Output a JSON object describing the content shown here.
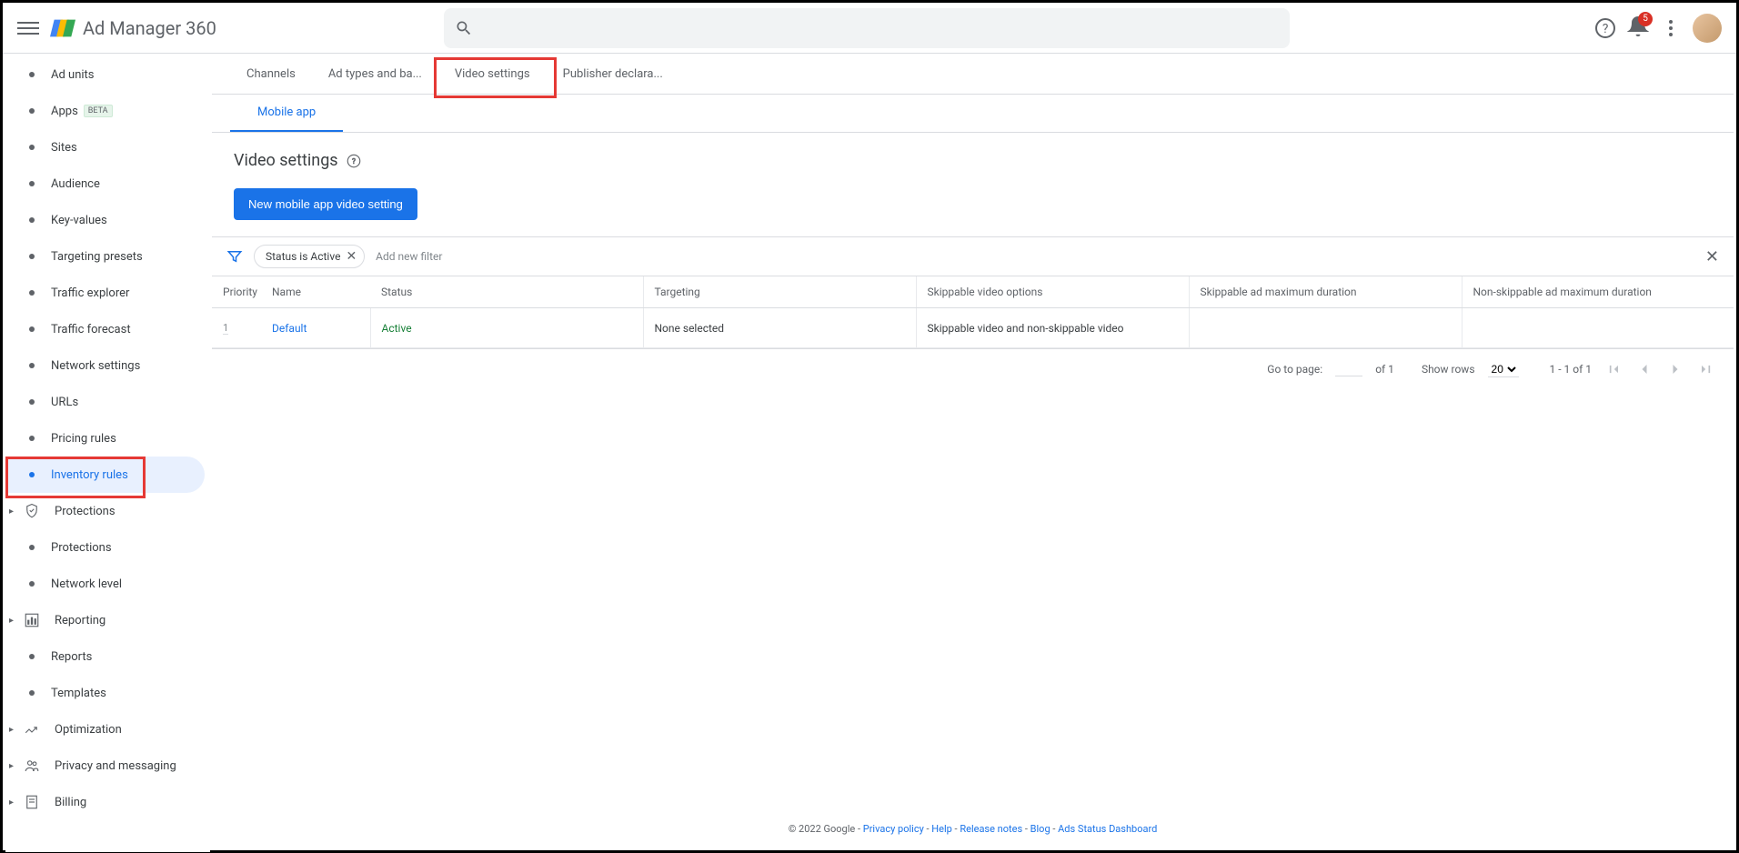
{
  "header": {
    "product": "Ad Manager 360",
    "notif_count": "5"
  },
  "sidebar": {
    "items": [
      {
        "label": "Ad units"
      },
      {
        "label": "Apps",
        "badge": "BETA"
      },
      {
        "label": "Sites"
      },
      {
        "label": "Audience"
      },
      {
        "label": "Key-values"
      },
      {
        "label": "Targeting presets"
      },
      {
        "label": "Traffic explorer"
      },
      {
        "label": "Traffic forecast"
      },
      {
        "label": "Network settings"
      },
      {
        "label": "URLs"
      },
      {
        "label": "Pricing rules"
      },
      {
        "label": "Inventory rules",
        "active": true,
        "highlighted": true
      },
      {
        "label": "Protections",
        "icon": "shield",
        "expandable": true
      },
      {
        "label": "Protections"
      },
      {
        "label": "Network level"
      },
      {
        "label": "Reporting",
        "icon": "chart",
        "expandable": true
      },
      {
        "label": "Reports"
      },
      {
        "label": "Templates"
      },
      {
        "label": "Optimization",
        "icon": "trend",
        "expandable": true
      },
      {
        "label": "Privacy and messaging",
        "icon": "people",
        "expandable": true
      },
      {
        "label": "Billing",
        "icon": "receipt",
        "expandable": true
      }
    ]
  },
  "tabs": {
    "row1": [
      "Channels",
      "Ad types and ba...",
      "Video settings",
      "Publisher declara..."
    ],
    "row1_active": 2,
    "row1_highlighted": 2,
    "row2": [
      "Mobile app"
    ],
    "row2_active": 0
  },
  "page": {
    "title": "Video settings",
    "new_button": "New mobile app video setting"
  },
  "filters": {
    "chip": "Status is Active",
    "add_placeholder": "Add new filter"
  },
  "table": {
    "columns": [
      "Priority",
      "Name",
      "Status",
      "Targeting",
      "Skippable video options",
      "Skippable ad maximum duration",
      "Non-skippable ad maximum duration"
    ],
    "rows": [
      {
        "priority": "1",
        "name": "Default",
        "status": "Active",
        "targeting": "None selected",
        "skippable": "Skippable video and non-skippable video",
        "sk_max": "",
        "nonsk_max": ""
      }
    ]
  },
  "pagination": {
    "goto_label": "Go to page:",
    "of_label": "of 1",
    "show_rows_label": "Show rows",
    "rows_value": "20",
    "range": "1 - 1 of 1"
  },
  "footer": {
    "copyright": "© 2022 Google",
    "links": [
      "Privacy policy",
      "Help",
      "Release notes",
      "Blog",
      "Ads Status Dashboard"
    ]
  }
}
